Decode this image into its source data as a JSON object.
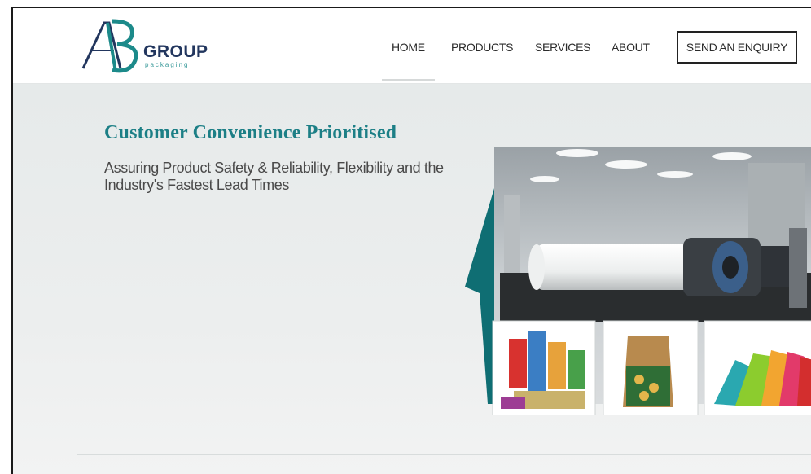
{
  "logo": {
    "initials": "AB",
    "group": "GROUP",
    "sub": "packaging"
  },
  "nav": {
    "items": [
      {
        "label": "HOME",
        "active": true
      },
      {
        "label": "PRODUCTS",
        "active": false
      },
      {
        "label": "SERVICES",
        "active": false
      },
      {
        "label": "ABOUT",
        "active": false
      }
    ],
    "enquiry": "SEND AN ENQUIRY"
  },
  "hero": {
    "headline": "Customer Convenience Prioritised",
    "subline": "Assuring Product Safety & Reliability, Flexibility and the Industry's Fastest Lead Times",
    "images": [
      "factory-roller-machine",
      "printed-labels-stack",
      "paper-bag",
      "colorful-shopping-bags"
    ]
  },
  "colors": {
    "accent": "#1c7f86",
    "navy": "#22365e",
    "text": "#2b2b2b"
  }
}
